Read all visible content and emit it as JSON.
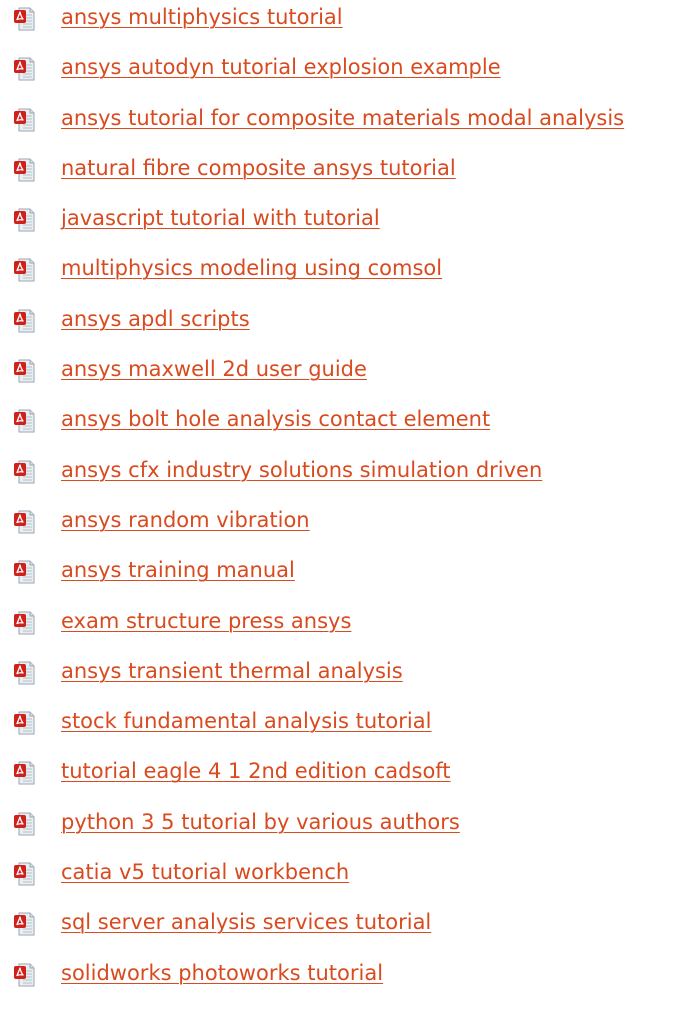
{
  "links": [
    {
      "label": "ansys multiphysics tutorial",
      "icon": "pdf-file-icon"
    },
    {
      "label": "ansys autodyn tutorial explosion example",
      "icon": "pdf-file-icon"
    },
    {
      "label": "ansys tutorial for composite materials modal analysis",
      "icon": "pdf-file-icon"
    },
    {
      "label": "natural fibre composite ansys tutorial",
      "icon": "pdf-file-icon"
    },
    {
      "label": "javascript tutorial with tutorial",
      "icon": "pdf-file-icon"
    },
    {
      "label": "multiphysics modeling using comsol",
      "icon": "pdf-file-icon"
    },
    {
      "label": "ansys apdl scripts",
      "icon": "pdf-file-icon"
    },
    {
      "label": "ansys maxwell 2d user guide",
      "icon": "pdf-file-icon"
    },
    {
      "label": "ansys bolt hole analysis contact element",
      "icon": "pdf-file-icon"
    },
    {
      "label": "ansys cfx industry solutions simulation driven",
      "icon": "pdf-file-icon"
    },
    {
      "label": "ansys random vibration",
      "icon": "pdf-file-icon"
    },
    {
      "label": "ansys training manual",
      "icon": "pdf-file-icon"
    },
    {
      "label": "exam structure press ansys",
      "icon": "pdf-file-icon"
    },
    {
      "label": "ansys transient thermal analysis",
      "icon": "pdf-file-icon"
    },
    {
      "label": "stock fundamental analysis tutorial",
      "icon": "pdf-file-icon"
    },
    {
      "label": "tutorial eagle 4 1 2nd edition cadsoft",
      "icon": "pdf-file-icon"
    },
    {
      "label": "python 3 5 tutorial by various authors",
      "icon": "pdf-file-icon"
    },
    {
      "label": "catia v5 tutorial workbench",
      "icon": "pdf-file-icon"
    },
    {
      "label": "sql server analysis services tutorial",
      "icon": "pdf-file-icon"
    },
    {
      "label": "solidworks photoworks tutorial",
      "icon": "pdf-file-icon"
    }
  ],
  "colors": {
    "link": "#d94a1e",
    "icon_red": "#d0201a",
    "icon_page": "#e9eef3",
    "background": "#ffffff"
  }
}
